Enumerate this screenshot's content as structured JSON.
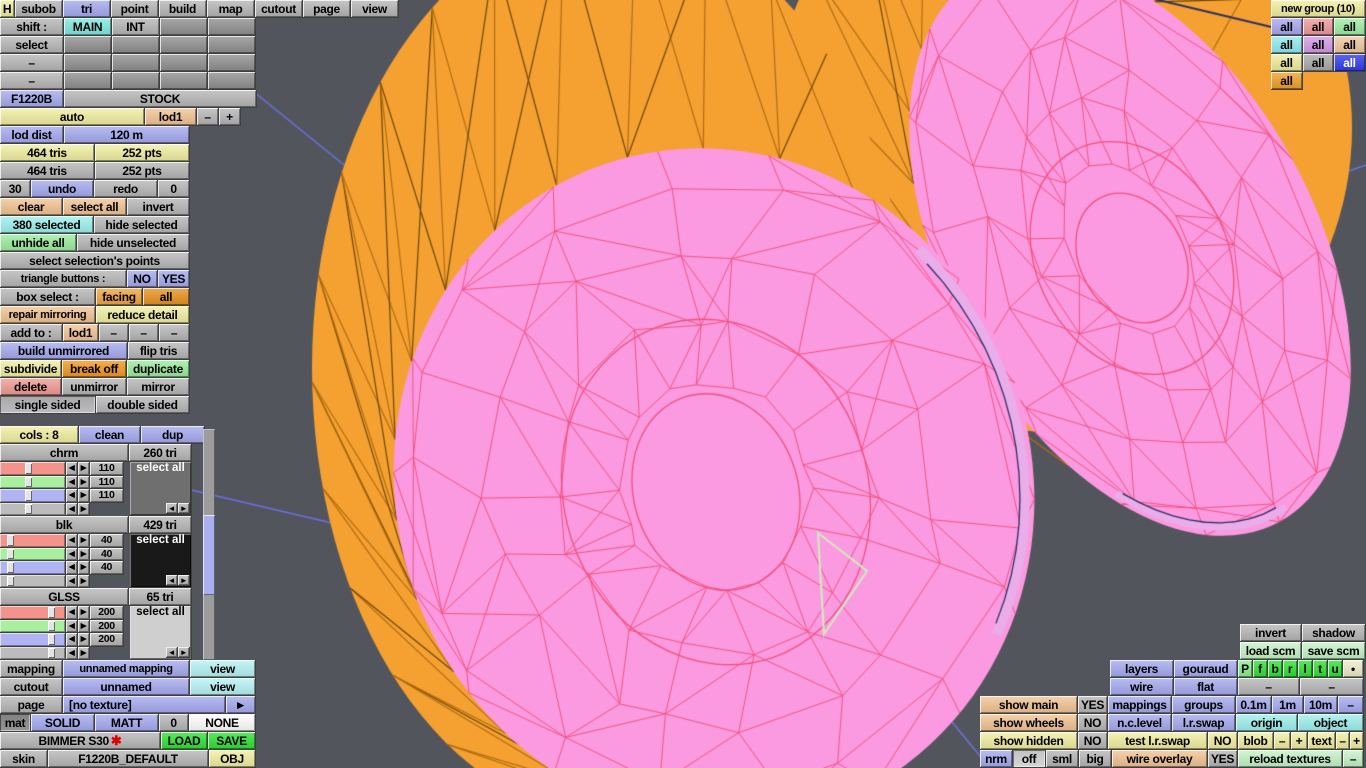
{
  "toolbar": {
    "tabs": [
      "H",
      "subob",
      "tri",
      "point",
      "build",
      "map",
      "cutout",
      "page",
      "view"
    ]
  },
  "shift_grid": {
    "row2_label": "shift :",
    "main": "MAIN",
    "int": "INT",
    "row3_label": "select",
    "row4_label": "–",
    "row5_label": "–"
  },
  "model": {
    "name": "F1220B",
    "variant": "STOCK",
    "auto": "auto",
    "lod": "lod1",
    "lod_dist_label": "lod dist",
    "lod_dist": "120 m",
    "tris_active": "464 tris",
    "pts_active": "252 pts",
    "tris_total": "464 tris",
    "pts_total": "252 pts",
    "undo_count": "30",
    "undo": "undo",
    "redo": "redo",
    "redo_count": "0"
  },
  "selection": {
    "clear": "clear",
    "select_all": "select all",
    "invert": "invert",
    "selected_count": "380 selected",
    "hide_selected": "hide selected",
    "unhide_all": "unhide all",
    "hide_unselected": "hide unselected",
    "select_points": "select selection's points",
    "triangle_buttons": "triangle buttons :",
    "no": "NO",
    "yes": "YES",
    "box_select": "box select :",
    "facing": "facing",
    "all": "all",
    "repair_mirroring": "repair mirroring",
    "reduce_detail": "reduce detail",
    "add_to": "add to :",
    "add_to_lod": "lod1"
  },
  "edit": {
    "build_unmirrored": "build unmirrored",
    "flip_tris": "flip tris",
    "subdivide": "subdivide",
    "break_off": "break off",
    "duplicate": "duplicate",
    "delete": "delete",
    "unmirror": "unmirror",
    "mirror": "mirror",
    "single_sided": "single sided",
    "double_sided": "double sided"
  },
  "colors": {
    "cols": "cols : 8",
    "clean": "clean",
    "dup": "dup",
    "select_all": "select all",
    "groups": [
      {
        "name": "chrm",
        "tris": "260 tri",
        "values": [
          110,
          110,
          110
        ],
        "swatch": "#6f6f6f",
        "swatch_text": "#ffffff"
      },
      {
        "name": "blk",
        "tris": "429 tri",
        "values": [
          40,
          40,
          40
        ],
        "swatch": "#191919",
        "swatch_text": "#ffffff"
      },
      {
        "name": "GLSS",
        "tris": "65 tri",
        "values": [
          200,
          200,
          200
        ],
        "swatch": "#cfcfcf",
        "swatch_text": "#000000"
      }
    ]
  },
  "material": {
    "mapping_label": "mapping",
    "mapping_name": "unnamed mapping",
    "view": "view",
    "cutout_label": "cutout",
    "cutout_name": "unnamed",
    "page_label": "page",
    "page_value": "[no texture]",
    "mat_label": "mat",
    "solid": "SOLID",
    "matt": "MATT",
    "zero": "0",
    "none": "NONE",
    "model_name": "BIMMER S30",
    "load": "LOAD",
    "save": "SAVE",
    "skin_label": "skin",
    "skin_name": "F1220B_DEFAULT",
    "obj": "OBJ"
  },
  "groups_panel": {
    "title": "new group (10)",
    "all": "all"
  },
  "right_panel": {
    "invert": "invert",
    "shadow": "shadow",
    "load_scm": "load scm",
    "save_scm": "save scm",
    "layers": "layers",
    "gouraud": "gouraud",
    "letters": [
      "P",
      "f",
      "b",
      "r",
      "l",
      "t",
      "u"
    ],
    "wire": "wire",
    "flat": "flat",
    "show_main": "show main",
    "yes": "YES",
    "no": "NO",
    "mappings": "mappings",
    "groups": "groups",
    "m01": "0.1m",
    "m1": "1m",
    "m10": "10m",
    "show_wheels": "show wheels",
    "nc_level": "n.c.level",
    "lr_swap": "l.r.swap",
    "origin": "origin",
    "object": "object",
    "show_hidden": "show hidden",
    "test_lr_swap": "test l.r.swap",
    "blob": "blob",
    "text": "text",
    "nrm": "nrm",
    "off": "off",
    "sml": "sml",
    "big": "big",
    "wire_overlay": "wire overlay",
    "reload_textures": "reload textures"
  },
  "glyphs": {
    "dash": "–",
    "minus": "–",
    "plus": "+",
    "left": "◄",
    "right": "►",
    "dot": "•",
    "star": "✱",
    "next": "►"
  },
  "viewport": {
    "background": "#53555d",
    "wheel_orange": "#f4a132",
    "wheel_pink": "#fb9ae0",
    "wire_pink": "#f3507c",
    "wire_orange": "#b46d10",
    "wire_orange_dark": "#6e4708",
    "axis_blue": "#6a72e2",
    "edge_navy": "#2b3166",
    "band_pink": "#e9aeea",
    "selected_triangle": "#cfe9c0"
  }
}
